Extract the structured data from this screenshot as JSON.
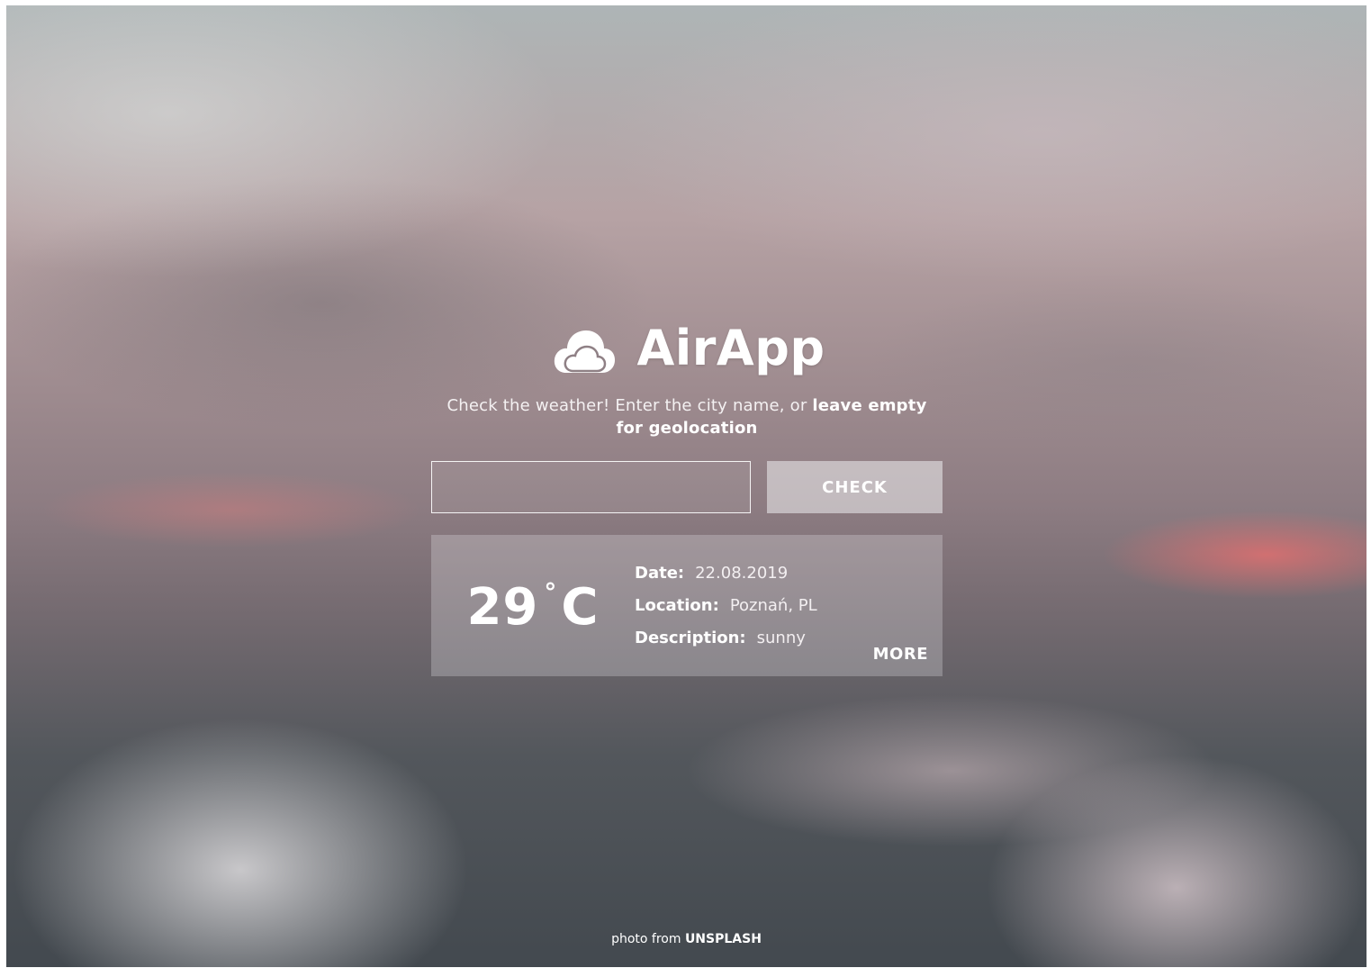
{
  "app": {
    "title": "AirApp",
    "logo_icon": "cloud-icon"
  },
  "intro": {
    "text_plain": "Check the weather! Enter the city name, or ",
    "text_bold": "leave empty for geolocation"
  },
  "search": {
    "value": "",
    "placeholder": "",
    "button_label": "CHECK"
  },
  "weather": {
    "temperature": "29",
    "degree_symbol": "°",
    "unit": "C",
    "date_label": "Date:",
    "date_value": "22.08.2019",
    "location_label": "Location:",
    "location_value": "Poznań, PL",
    "description_label": "Description:",
    "description_value": "sunny",
    "more_label": "MORE"
  },
  "footer": {
    "prefix": "photo from",
    "link_label": "UNSPLASH"
  },
  "colors": {
    "text": "#ffffff",
    "card_background": "rgba(235,232,236,0.28)",
    "button_background": "rgba(238,238,240,0.55)"
  }
}
